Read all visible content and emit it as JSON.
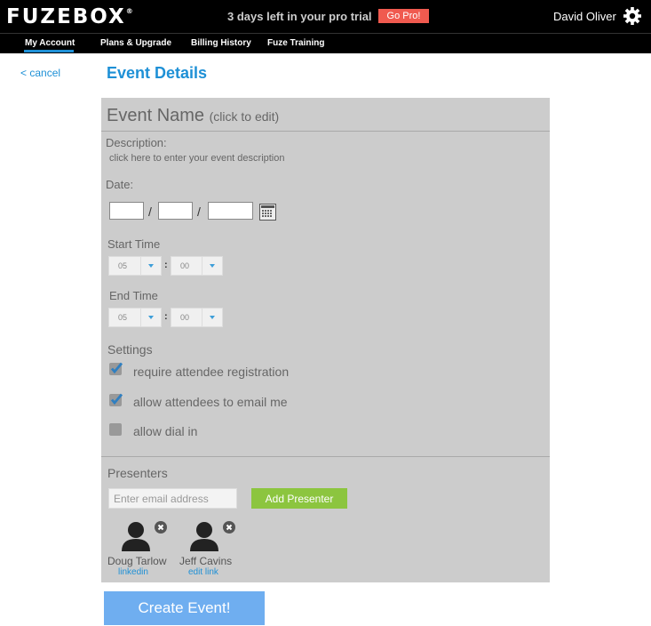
{
  "brand": {
    "logo": "FUZEBOX",
    "logo_mark": "®"
  },
  "topbar": {
    "trial_text": "3 days left in your pro trial",
    "gopro_label": "Go Pro!",
    "user_name": "David Oliver"
  },
  "nav": {
    "items": [
      {
        "label": "My Account"
      },
      {
        "label": "Plans & Upgrade"
      },
      {
        "label": "Billing History"
      },
      {
        "label": "Fuze Training"
      }
    ],
    "active_index": 0
  },
  "header": {
    "cancel_label": "< cancel",
    "title": "Event Details"
  },
  "form": {
    "event_name": "Event Name",
    "event_name_hint": "(click to edit)",
    "description_label": "Description:",
    "description_hint": "click here to enter your event description",
    "date_label": "Date:",
    "date_separator": "/",
    "start_time_label": "Start Time",
    "start_hour": "05",
    "start_minute": "00",
    "end_time_label": "End Time",
    "end_hour": "05",
    "end_minute": "00",
    "time_separator": ":",
    "settings_label": "Settings",
    "settings": [
      {
        "label": "require attendee registration",
        "checked": true
      },
      {
        "label": "allow attendees to email me",
        "checked": true
      },
      {
        "label": "allow dial in",
        "checked": false
      }
    ],
    "presenters_label": "Presenters",
    "email_placeholder": "Enter email address",
    "add_presenter_label": "Add Presenter",
    "presenters": [
      {
        "name": "Doug Tarlow",
        "link": "linkedin"
      },
      {
        "name": "Jeff Cavins",
        "link": "edit link"
      }
    ]
  },
  "create_label": "Create Event!",
  "colors": {
    "accent": "#1e90d6",
    "gopro": "#f05a4f",
    "add": "#8cc53f",
    "create": "#6faef0",
    "panel": "#cccccc"
  }
}
